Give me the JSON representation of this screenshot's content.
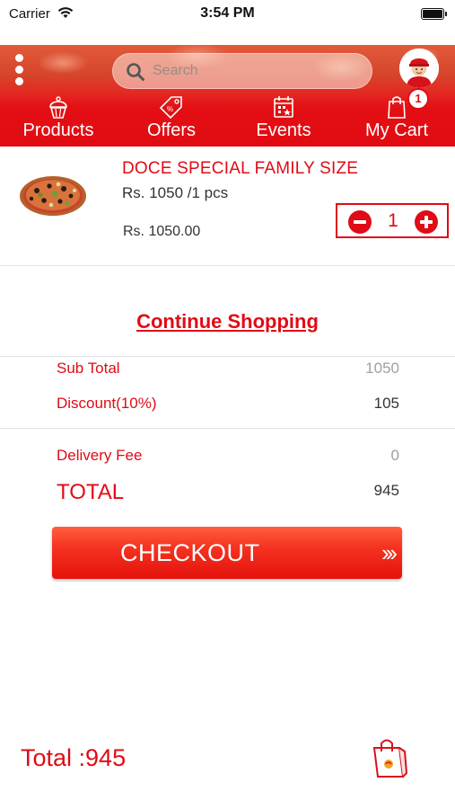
{
  "status_bar": {
    "carrier": "Carrier",
    "time": "3:54 PM"
  },
  "header": {
    "search_placeholder": "Search",
    "nav": [
      {
        "label": "Products",
        "icon": "cupcake-icon"
      },
      {
        "label": "Offers",
        "icon": "offer-tag-icon"
      },
      {
        "label": "Events",
        "icon": "calendar-icon"
      },
      {
        "label": "My Cart",
        "icon": "shopping-bag-icon"
      }
    ],
    "cart_count": "1"
  },
  "cart_item": {
    "name": "DOCE SPECIAL FAMILY SIZE",
    "unit_price": "Rs. 1050 /1 pcs",
    "line_total": "Rs. 1050.00",
    "quantity": "1"
  },
  "continue_label": "Continue Shopping",
  "summary": {
    "subtotal_label": "Sub Total",
    "subtotal_value": "1050",
    "discount_label": "Discount(10%)",
    "discount_value": "105",
    "delivery_label": "Delivery Fee",
    "delivery_value": "0",
    "total_label": "TOTAL",
    "total_value": "945"
  },
  "checkout": {
    "label": "CHECKOUT",
    "arrows": "›››"
  },
  "footer": {
    "total_text": "Total :945"
  },
  "colors": {
    "brand_red": "#e00b16"
  }
}
